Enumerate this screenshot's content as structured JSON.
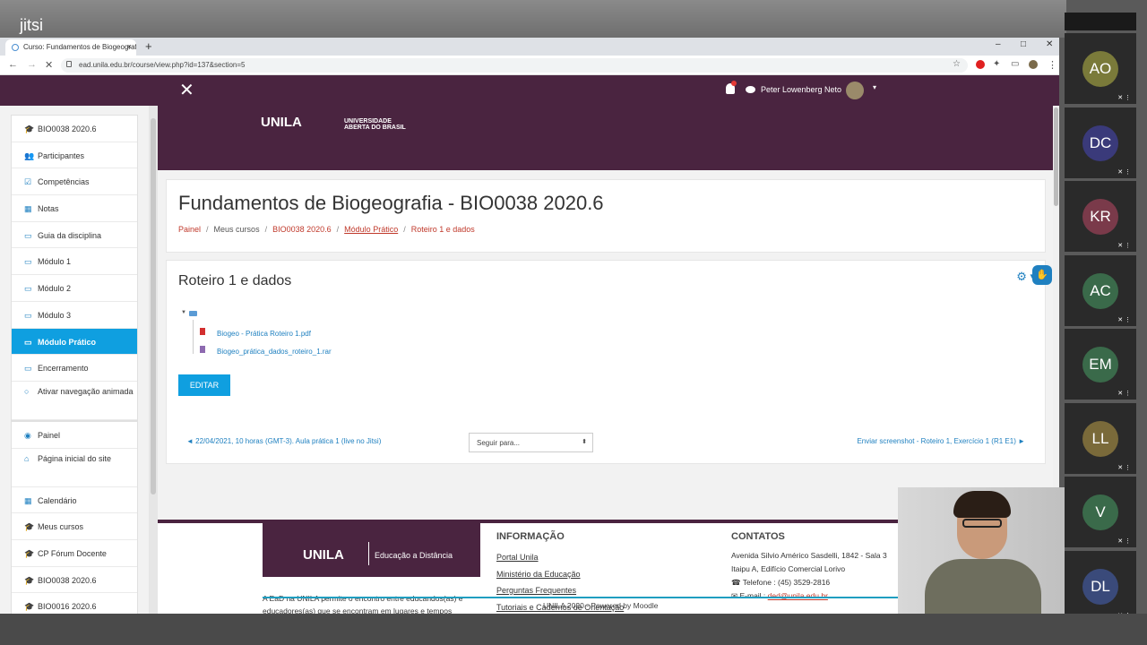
{
  "jitsi": {
    "logo": "jitsi"
  },
  "browser": {
    "tab_title": "Curso: Fundamentos de Biogeografia",
    "tab_close": "×",
    "new_tab": "+",
    "win_min": "–",
    "win_max": "□",
    "win_close": "✕",
    "url": "ead.unila.edu.br/course/view.php?id=137&section=5"
  },
  "nav": {
    "close": "✕",
    "username": "Peter Lowenberg Neto",
    "caret": "▾"
  },
  "banner": {
    "unila": "UNILA",
    "uab": "UNIVERSIDADE ABERTA DO BRASIL"
  },
  "sidebar": {
    "group1": [
      {
        "label": "BIO0038 2020.6",
        "icon": "graduation-cap-icon",
        "glyph": "🎓"
      },
      {
        "label": "Participantes",
        "icon": "users-icon",
        "glyph": "👥"
      },
      {
        "label": "Competências",
        "icon": "check-square-icon",
        "glyph": "☑"
      },
      {
        "label": "Notas",
        "icon": "table-icon",
        "glyph": "▦"
      },
      {
        "label": "Guia da disciplina",
        "icon": "folder-icon",
        "glyph": "▭"
      },
      {
        "label": "Módulo 1",
        "icon": "folder-icon",
        "glyph": "▭"
      },
      {
        "label": "Módulo 2",
        "icon": "folder-icon",
        "glyph": "▭"
      },
      {
        "label": "Módulo 3",
        "icon": "folder-icon",
        "glyph": "▭"
      },
      {
        "label": "Módulo Prático",
        "icon": "folder-icon",
        "glyph": "▭"
      },
      {
        "label": "Encerramento",
        "icon": "folder-icon",
        "glyph": "▭"
      },
      {
        "label": "Ativar navegação animada",
        "icon": "circle-icon",
        "glyph": "○"
      }
    ],
    "group2": [
      {
        "label": "Painel",
        "icon": "dashboard-icon",
        "glyph": "◉"
      },
      {
        "label": "Página inicial do site",
        "icon": "home-icon",
        "glyph": "⌂"
      },
      {
        "label": "Calendário",
        "icon": "calendar-icon",
        "glyph": "▦"
      },
      {
        "label": "Meus cursos",
        "icon": "graduation-cap-icon",
        "glyph": "🎓"
      },
      {
        "label": "CP Fórum Docente",
        "icon": "graduation-cap-icon",
        "glyph": "🎓"
      },
      {
        "label": "BIO0038 2020.6",
        "icon": "graduation-cap-icon",
        "glyph": "🎓"
      },
      {
        "label": "BIO0016 2020.6",
        "icon": "graduation-cap-icon",
        "glyph": "🎓"
      }
    ]
  },
  "course": {
    "title": "Fundamentos de Biogeografia - BIO0038 2020.6",
    "breadcrumb": [
      "Painel",
      "Meus cursos",
      "BIO0038 2020.6",
      "Módulo Prático",
      "Roteiro 1 e dados"
    ],
    "separator": "/"
  },
  "section": {
    "title": "Roteiro 1 e dados",
    "gear": "⚙ ▾",
    "files": [
      "Biogeo - Prática Roteiro 1.pdf",
      "Biogeo_prática_dados_roteiro_1.rar"
    ],
    "edit_label": "EDITAR",
    "prev": "◄ 22/04/2021, 10 horas (GMT-3). Aula prática 1 (live no Jitsi)",
    "jump": "Seguir para...",
    "next": "Enviar screenshot - Roteiro 1, Exercício 1 (R1 E1) ►"
  },
  "footer": {
    "logo_text": "UNILA",
    "logo_sub": "Educação a Distância",
    "desc": "A EaD na UNILA permite o encontro entre educandos(as) e educadores(as) que se encontram em lugares e tempos diversos da América Latina e do Caribe.",
    "info_title": "INFORMAÇÃO",
    "info_links": [
      "Portal Unila",
      "Ministério da Educação",
      "Perguntas Frequentes",
      "Tutoriais e Cadernos de Orientação"
    ],
    "contact_title": "CONTATOS",
    "address1": "Avenida Silvio Américo Sasdelli, 1842 - Sala 3",
    "address2": "Itaipu A, Edifício Comercial Lorivo",
    "phone": "☎ Telefone : (45) 3529-2816",
    "email_label": "✉ E-mail :",
    "email": "ded@unila.edu.br",
    "powered": "UNILA 2020 - Powered by Moodle"
  },
  "participants": [
    {
      "initials": "AO",
      "color": "#7a7a3a"
    },
    {
      "initials": "DC",
      "color": "#3a3a7a"
    },
    {
      "initials": "KR",
      "color": "#7a3a4a"
    },
    {
      "initials": "AC",
      "color": "#3a6a4a"
    },
    {
      "initials": "EM",
      "color": "#3a6a4a"
    },
    {
      "initials": "LL",
      "color": "#7a6a3a"
    },
    {
      "initials": "V",
      "color": "#3a6a4a"
    },
    {
      "initials": "DL",
      "color": "#3a4a7a"
    }
  ]
}
